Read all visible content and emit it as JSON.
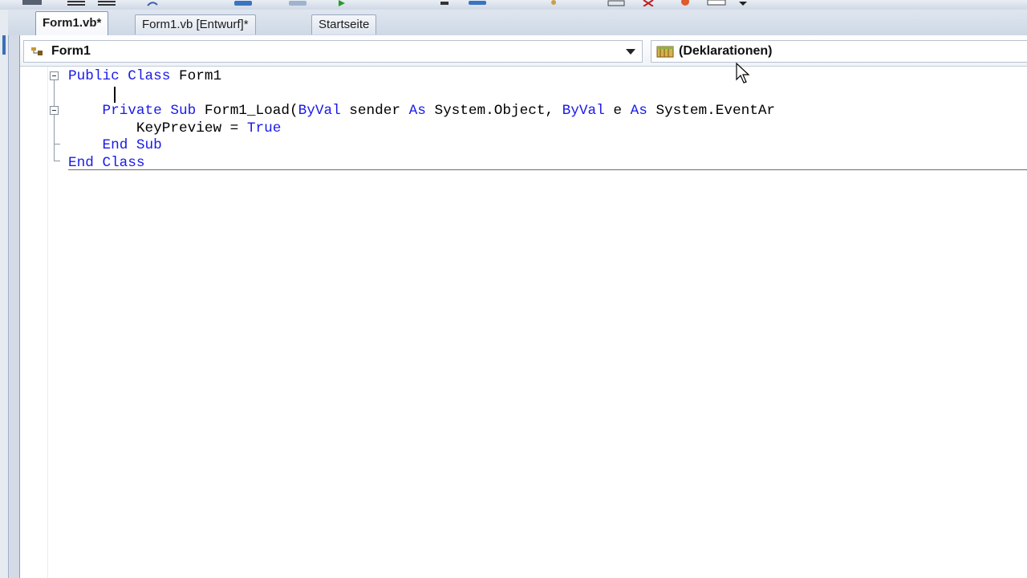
{
  "tabs": [
    {
      "label": "Form1.vb*",
      "active": true
    },
    {
      "label": "Form1.vb [Entwurf]*",
      "active": false
    },
    {
      "label": "Startseite",
      "active": false
    }
  ],
  "navbar": {
    "class_combo": {
      "value": "Form1",
      "icon": "class-icon"
    },
    "member_combo": {
      "value": "(Deklarationen)",
      "icon": "declarations-icon"
    }
  },
  "code": {
    "lines": [
      {
        "indent": "",
        "tokens": [
          {
            "t": "Public Class",
            "kw": true
          },
          {
            "t": " Form1",
            "kw": false
          }
        ]
      },
      {
        "indent": "",
        "tokens": []
      },
      {
        "indent": "    ",
        "tokens": [
          {
            "t": "Private Sub",
            "kw": true
          },
          {
            "t": " Form1_Load(",
            "kw": false
          },
          {
            "t": "ByVal",
            "kw": true
          },
          {
            "t": " sender ",
            "kw": false
          },
          {
            "t": "As",
            "kw": true
          },
          {
            "t": " System.Object, ",
            "kw": false
          },
          {
            "t": "ByVal",
            "kw": true
          },
          {
            "t": " e ",
            "kw": false
          },
          {
            "t": "As",
            "kw": true
          },
          {
            "t": " System.EventAr",
            "kw": false
          }
        ]
      },
      {
        "indent": "        ",
        "tokens": [
          {
            "t": "KeyPreview = ",
            "kw": false
          },
          {
            "t": "True",
            "kw": true
          }
        ]
      },
      {
        "indent": "    ",
        "tokens": [
          {
            "t": "End Sub",
            "kw": true
          }
        ]
      },
      {
        "indent": "",
        "tokens": [
          {
            "t": "End Class",
            "kw": true
          }
        ]
      }
    ]
  },
  "colors": {
    "keyword": "#1a1ae6",
    "text": "#000000",
    "tab_bar": "#d4dbe6"
  }
}
